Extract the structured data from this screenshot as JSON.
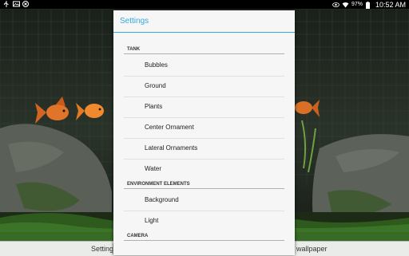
{
  "status_bar": {
    "battery_percent": "97%",
    "time": "10:52 AM"
  },
  "bottom_bar": {
    "left_label": "Settings",
    "right_label": "t wallpaper"
  },
  "dialog": {
    "title": "Settings",
    "sections": [
      {
        "header": "TANK",
        "items": [
          "Bubbles",
          "Ground",
          "Plants",
          "Center Ornament",
          "Lateral Ornaments",
          "Water"
        ]
      },
      {
        "header": "ENVIRONMENT ELEMENTS",
        "items": [
          "Background",
          "Light"
        ]
      },
      {
        "header": "CAMERA",
        "items": []
      }
    ]
  },
  "colors": {
    "accent": "#35a7de",
    "fish": "#e0752a"
  }
}
